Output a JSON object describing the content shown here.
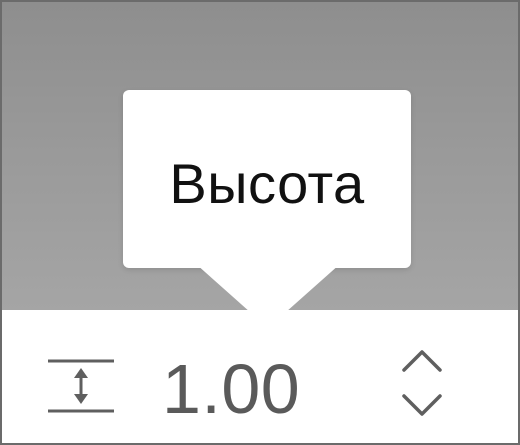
{
  "tooltip": {
    "text": "Высота"
  },
  "height_control": {
    "icon": "line-height-icon",
    "value": "1.00",
    "stepper_up_icon": "chevron-up-icon",
    "stepper_down_icon": "chevron-down-icon"
  },
  "colors": {
    "background": "#9a9a9a",
    "panel": "#ffffff",
    "value_text": "#5a5a5a",
    "icon": "#5f5f5f"
  }
}
